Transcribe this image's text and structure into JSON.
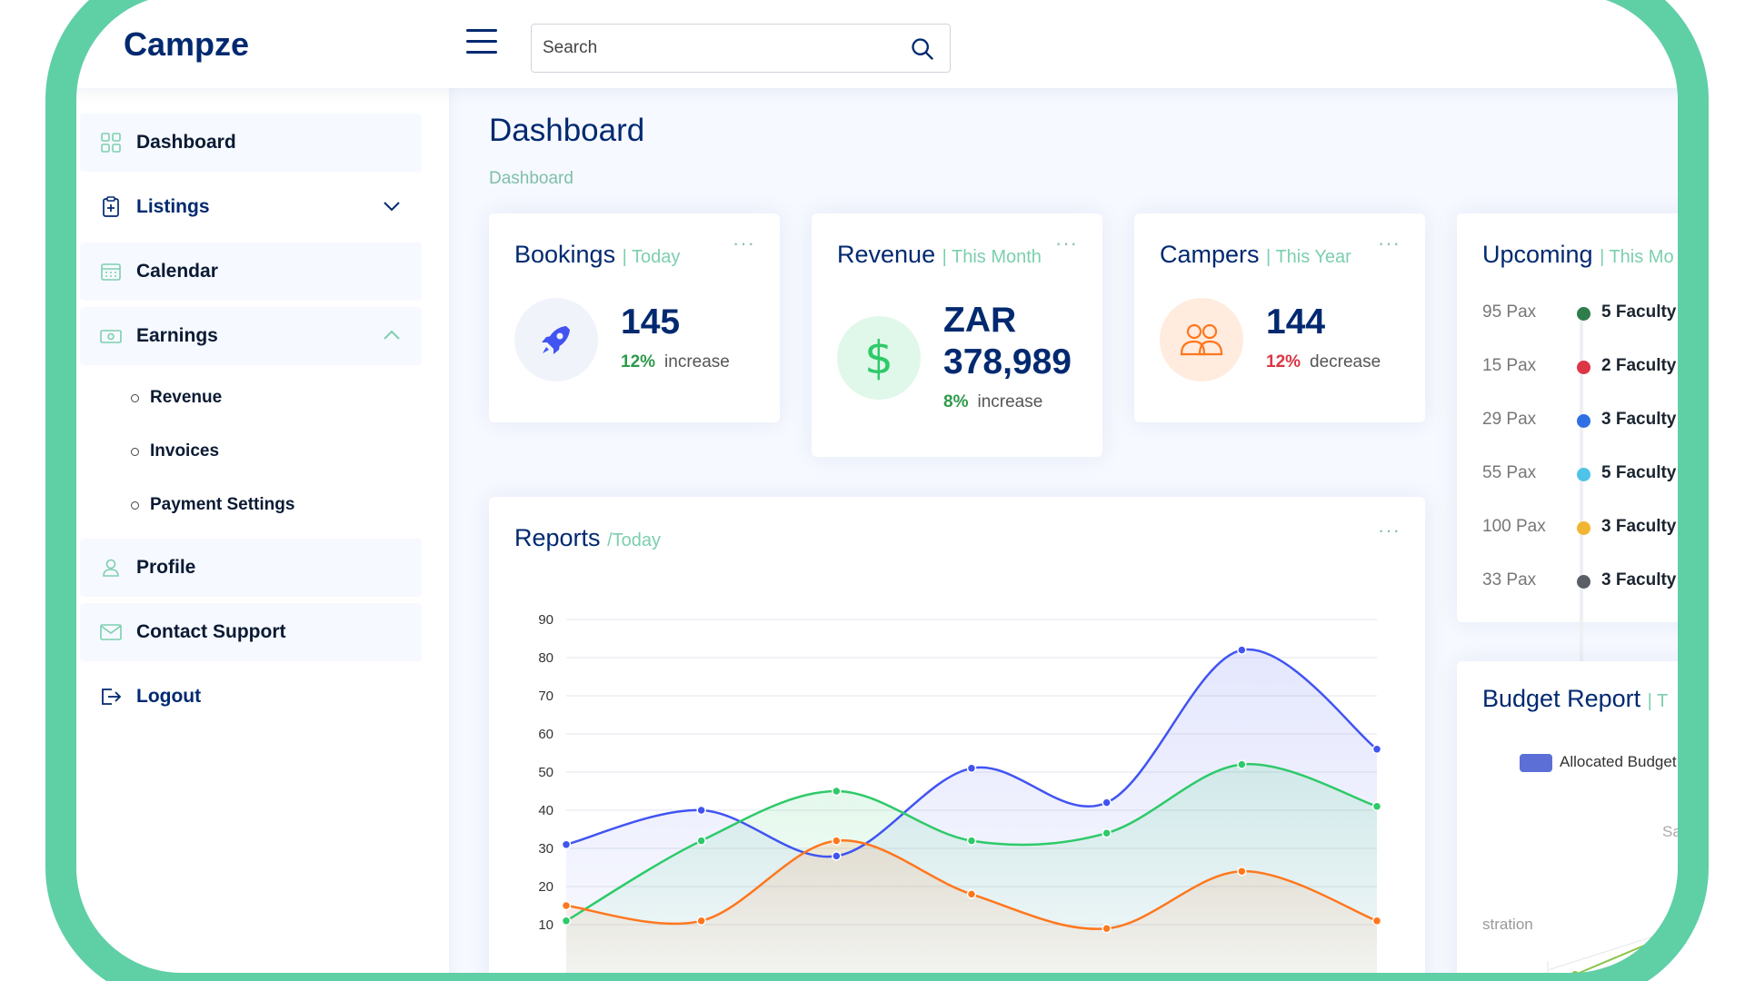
{
  "app": {
    "logo": "Campze"
  },
  "header": {
    "search_placeholder": "Search"
  },
  "sidebar": {
    "items": [
      {
        "label": "Dashboard"
      },
      {
        "label": "Listings"
      },
      {
        "label": "Calendar"
      },
      {
        "label": "Earnings"
      },
      {
        "label": "Profile"
      },
      {
        "label": "Contact Support"
      },
      {
        "label": "Logout"
      }
    ],
    "earnings_sub": [
      {
        "label": "Revenue"
      },
      {
        "label": "Invoices"
      },
      {
        "label": "Payment Settings"
      }
    ]
  },
  "page": {
    "title": "Dashboard",
    "breadcrumb": "Dashboard"
  },
  "cards": {
    "bookings": {
      "title": "Bookings",
      "period": "| Today",
      "value": "145",
      "change_pct": "12%",
      "change_word": "increase",
      "change_color": "#2e9a4a",
      "menu": "···"
    },
    "revenue": {
      "title": "Revenue",
      "period": "| This Month",
      "value_line1": "ZAR",
      "value_line2": "378,989",
      "change_pct": "8%",
      "change_word": "increase",
      "change_color": "#2e9a4a",
      "menu": "···"
    },
    "campers": {
      "title": "Campers",
      "period": "| This Year",
      "value": "144",
      "change_pct": "12%",
      "change_word": "decrease",
      "change_color": "#dc3545",
      "menu": "···"
    },
    "upcoming": {
      "title": "Upcoming",
      "period": "| This Mo",
      "items": [
        {
          "pax": "95 Pax",
          "label": "5 Faculty",
          "color": "#2e7d4a"
        },
        {
          "pax": "15 Pax",
          "label": "2 Faculty",
          "color": "#dc3545"
        },
        {
          "pax": "29 Pax",
          "label": "3 Faculty",
          "color": "#2f6fe4"
        },
        {
          "pax": "55 Pax",
          "label": "5 Faculty",
          "color": "#4fc3e8"
        },
        {
          "pax": "100 Pax",
          "label": "3 Faculty",
          "color": "#f2b533"
        },
        {
          "pax": "33 Pax",
          "label": "3 Faculty",
          "color": "#5a5f66"
        }
      ]
    },
    "reports": {
      "title": "Reports",
      "period": "/Today",
      "menu": "···"
    },
    "budget": {
      "title": "Budget Report",
      "period": "| T",
      "legend": "Allocated Budget",
      "radar_label_1": "Sa",
      "radar_label_2": "stration"
    }
  },
  "chart_data": {
    "type": "area",
    "title": "Reports",
    "ylim": [
      10,
      90
    ],
    "yticks": [
      10,
      20,
      30,
      40,
      50,
      60,
      70,
      80,
      90
    ],
    "x": [
      0,
      1,
      2,
      3,
      4,
      5,
      6
    ],
    "grid": true,
    "series": [
      {
        "color": "#4154f1",
        "values": [
          31,
          40,
          28,
          51,
          42,
          82,
          56
        ]
      },
      {
        "color": "#2eca6a",
        "values": [
          11,
          32,
          45,
          32,
          34,
          52,
          41
        ]
      },
      {
        "color": "#ff771d",
        "values": [
          15,
          11,
          32,
          18,
          9,
          24,
          11
        ]
      }
    ]
  }
}
